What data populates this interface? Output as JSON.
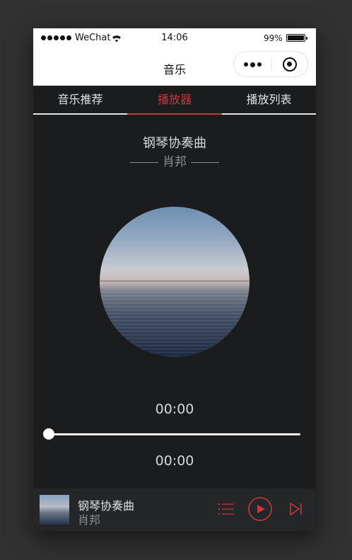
{
  "status_bar": {
    "carrier": "WeChat",
    "time": "14:06",
    "battery_percent": "99%",
    "battery_level": 0.99,
    "signal_icon": "signal-dots-icon",
    "wifi_icon": "wifi-icon",
    "battery_icon": "battery-icon"
  },
  "nav_bar": {
    "title": "音乐",
    "more_icon": "more-dots-icon",
    "close_icon": "target-icon"
  },
  "tabs": [
    {
      "label": "音乐推荐",
      "active": false
    },
    {
      "label": "播放器",
      "active": true
    },
    {
      "label": "播放列表",
      "active": false
    }
  ],
  "player": {
    "song_title": "钢琴协奏曲",
    "artist": "肖邦",
    "current_time": "00:00",
    "total_time": "00:00",
    "progress": 0
  },
  "mini_player": {
    "title": "钢琴协奏曲",
    "artist": "肖邦",
    "list_icon": "playlist-icon",
    "play_icon": "play-circle-icon",
    "next_icon": "skip-next-icon"
  },
  "colors": {
    "accent": "#c8383f",
    "background": "#1b1c1e",
    "mini_player_bg": "#252628",
    "frame_bg": "#313131"
  }
}
